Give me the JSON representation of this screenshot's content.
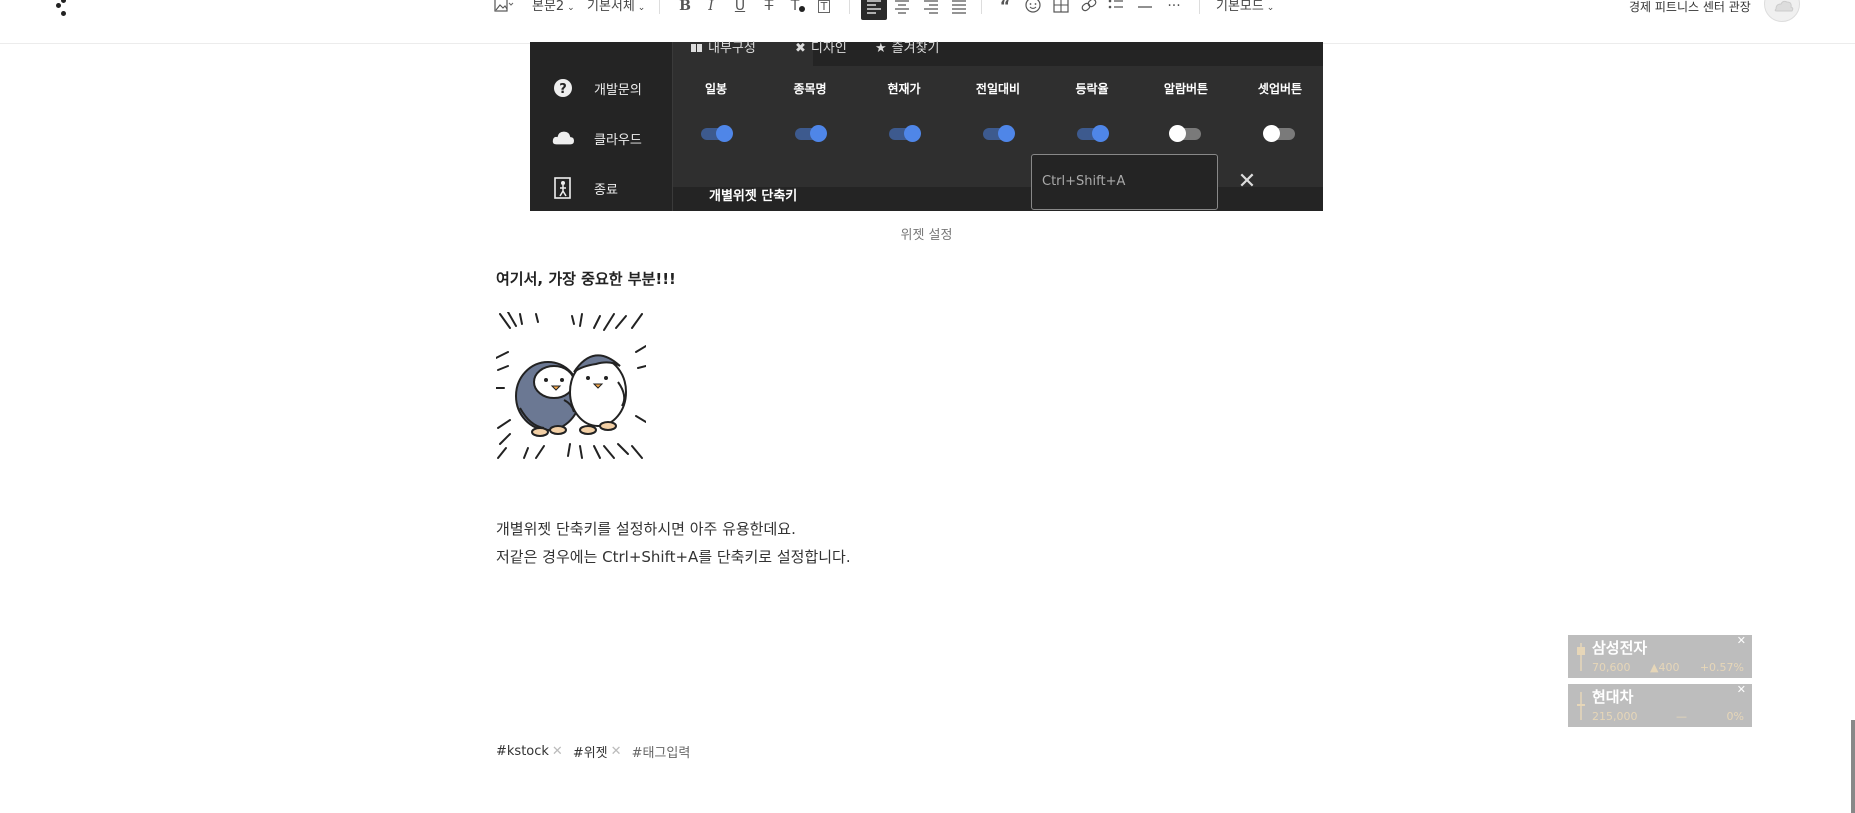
{
  "toolbar": {
    "style_label": "본문2",
    "font_label": "기본서체",
    "mode_label": "기본모드",
    "title": "경제 피트니스 센터 관장",
    "colors": {
      "active_align_bg": "#2a2a2a",
      "icon": "#555555"
    }
  },
  "widget": {
    "sidebar": [
      {
        "label": "개발문의",
        "icon": "help-circle-icon"
      },
      {
        "label": "클라우드",
        "icon": "cloud-icon"
      },
      {
        "label": "종료",
        "icon": "exit-icon"
      }
    ],
    "tabs": [
      {
        "label": "내부구성",
        "icon": "grid-icon",
        "active": true
      },
      {
        "label": "디자인",
        "icon": "tools-icon",
        "active": false
      },
      {
        "label": "즐겨찾기",
        "icon": "star-icon",
        "active": false
      }
    ],
    "toggles": [
      {
        "label": "일봉",
        "on": true
      },
      {
        "label": "종목명",
        "on": true
      },
      {
        "label": "현재가",
        "on": true
      },
      {
        "label": "전일대비",
        "on": true
      },
      {
        "label": "등락율",
        "on": true
      },
      {
        "label": "알람버튼",
        "on": false
      },
      {
        "label": "셋업버튼",
        "on": false
      }
    ],
    "shortcut": {
      "label": "개별위젯 단축키",
      "value": "Ctrl+Shift+A"
    },
    "colors": {
      "bg": "#242424",
      "panel": "#2f2f2f",
      "toggle_on": "#4f86e8"
    }
  },
  "caption": "위젯 설정",
  "heading": "여기서, 가장 중요한 부분!!!",
  "paragraphs": [
    "개별위젯 단축키를 설정하시면 아주 유용한데요.",
    "저같은 경우에는 Ctrl+Shift+A를 단축키로 설정합니다."
  ],
  "tags": [
    "#kstock",
    "#위젯",
    "#태그입력"
  ],
  "stock_widgets": [
    {
      "name": "삼성전자",
      "price": "70,600",
      "change": "▲400",
      "rate": "+0.57%"
    },
    {
      "name": "현대차",
      "price": "215,000",
      "change": "—",
      "rate": "0%"
    }
  ]
}
